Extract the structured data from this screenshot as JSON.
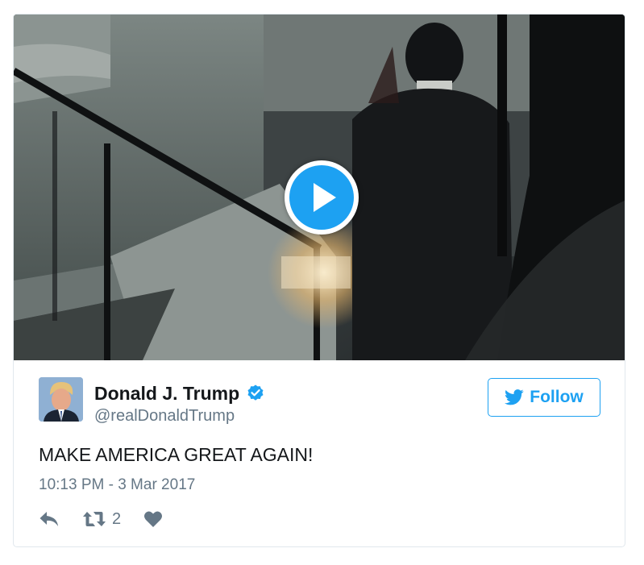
{
  "tweet": {
    "display_name": "Donald J. Trump",
    "handle": "@realDonaldTrump",
    "verified": true,
    "text": "MAKE AMERICA GREAT AGAIN!",
    "timestamp": "10:13 PM - 3 Mar 2017",
    "retweet_count": "2"
  },
  "follow_button": {
    "label": "Follow"
  },
  "media": {
    "type": "video",
    "play_icon": "play-icon"
  },
  "icons": {
    "verified": "verified-badge-icon",
    "follow": "twitter-bird-icon",
    "reply": "reply-icon",
    "retweet": "retweet-icon",
    "like": "heart-icon"
  },
  "colors": {
    "accent": "#1da1f2",
    "text": "#14171a",
    "secondary_text": "#657786",
    "border": "#e1e8ed"
  }
}
